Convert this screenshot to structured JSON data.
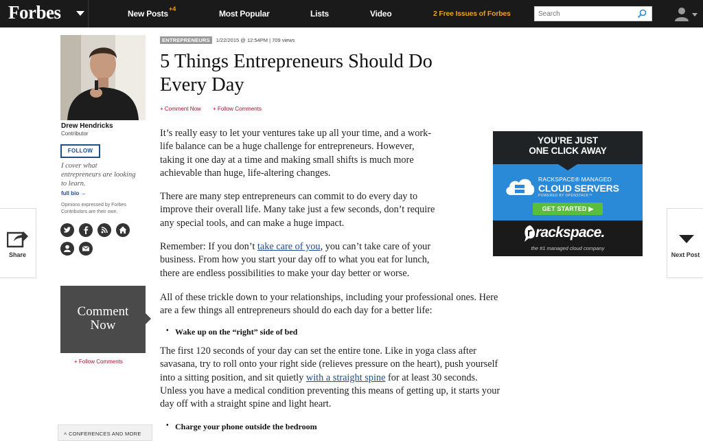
{
  "nav": {
    "logo": "Forbes",
    "items": [
      {
        "label": "New Posts",
        "badge": "+4"
      },
      {
        "label": "Most Popular"
      },
      {
        "label": "Lists"
      },
      {
        "label": "Video"
      }
    ],
    "promo": "2 Free Issues of Forbes",
    "search_placeholder": "Search"
  },
  "side": {
    "share": "Share",
    "next": "Next Post"
  },
  "author": {
    "name": "Drew Hendricks",
    "role": "Contributor",
    "follow": "FOLLOW",
    "bio": "I cover what entrepreneurs are looking to learn.",
    "full_bio": "full bio →",
    "disclaimer": "Opinions expressed by Forbes Contributors are their own.",
    "social_icons": [
      "twitter-icon",
      "facebook-icon",
      "rss-icon",
      "home-icon",
      "profile-icon",
      "email-icon"
    ]
  },
  "comment_box": {
    "line1": "Comment",
    "line2": "Now",
    "follow": "+ Follow Comments"
  },
  "conferences": "˄  CONFERENCES AND MORE",
  "article": {
    "category": "ENTREPRENEURS",
    "date": "1/22/2015 @ 12:54PM",
    "sep": "|",
    "views": "709 views",
    "title_l1": "5 Things Entrepreneurs Should Do",
    "title_l2": "Every Day",
    "comment_now": "+ Comment Now",
    "follow_comments": "+ Follow Comments",
    "p1": [
      "It’s really easy to let your ventures take up all your time, and a work-",
      "life balance can be a huge challenge for entrepreneurs. However,",
      "taking it one day at a time and making small shifts is much more",
      "achievable than huge, life-altering changes."
    ],
    "p2": [
      "There are many step entrepreneurs can commit to do every day to",
      "improve their overall life. Many take just a few seconds, don’t require",
      "any special tools, and can make a huge impact."
    ],
    "p3_pre": "Remember: If you don’t ",
    "p3_link": "take care of you",
    "p3_post": ", you can’t take care of your",
    "p3_rest": [
      "business. From how you start your day off to what you eat for lunch,",
      "there are endless possibilities to make your day better or worse."
    ],
    "p4": [
      "All of these trickle down to your relationships, including your professional ones. Here",
      "are a few things all entrepreneurs should do each day for a better life:"
    ],
    "bullet1": "Wake up on the “right” side of bed",
    "p5_l1": "The first 120 seconds of your day can set the entire tone. Like in yoga class after",
    "p5_l2": "savasana, try to roll onto your right side (relieves pressure on the heart), push yourself",
    "p5_l3_pre": "into a sitting position, and sit quietly ",
    "p5_l3_link": "with a straight spine",
    "p5_l3_post": " for at least 30 seconds.",
    "p5_l4": "Unless you have a medical condition preventing this means of getting up, it starts your",
    "p5_l5": "day off with a straight spine and light heart.",
    "bullet2": "Charge your phone outside the bedroom"
  },
  "ad": {
    "head1": "YOU’RE JUST",
    "head2": "ONE CLICK AWAY",
    "line1": "RACKSPACE® MANAGED",
    "line2": "CLOUD SERVERS",
    "line3": "POWERED BY OPENSTACK™",
    "button": "GET STARTED",
    "brand": "rackspace.",
    "tagline": "the #1 managed cloud company"
  }
}
